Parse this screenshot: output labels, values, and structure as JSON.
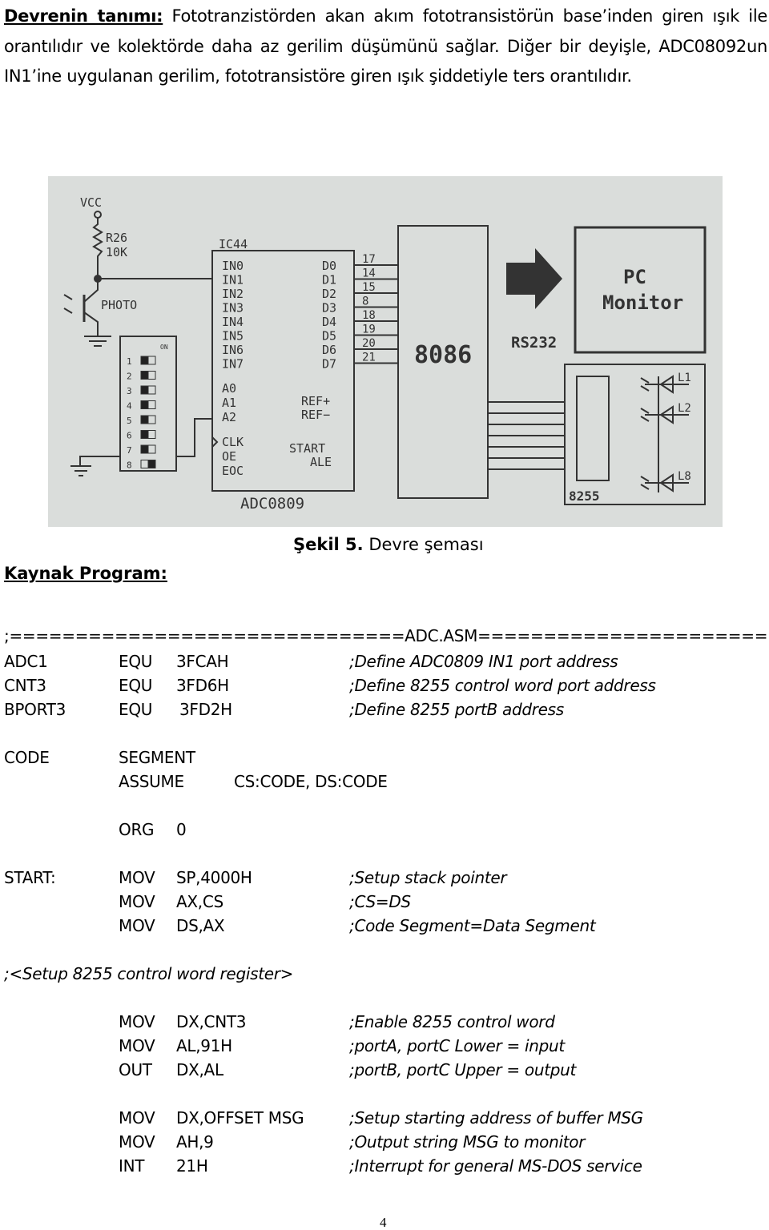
{
  "intro": {
    "heading": "Devrenin tanımı:",
    "text": " Fototranzistörden akan akım fototransistörün base’inden giren ışık ile orantılıdır ve kolektörde daha az gerilim düşümünü sağlar. Diğer bir deyişle, ADC08092un IN1’ine uygulanan gerilim, fototransistöre  giren ışık şiddetiyle ters orantılıdır."
  },
  "figure": {
    "labels": {
      "vcc": "VCC",
      "r26": "R26",
      "r_val": "10K",
      "photo": "PHOTO",
      "ic": "IC44",
      "adc": "ADC0809",
      "inputs": [
        "IN0",
        "IN1",
        "IN2",
        "IN3",
        "IN4",
        "IN5",
        "IN6",
        "IN7"
      ],
      "outputs": [
        "D0",
        "D1",
        "D2",
        "D3",
        "D4",
        "D5",
        "D6",
        "D7"
      ],
      "pins": [
        "17",
        "14",
        "15",
        "8",
        "18",
        "19",
        "20",
        "21"
      ],
      "addr": [
        "A0",
        "A1",
        "A2"
      ],
      "ctrl_left": [
        "CLK",
        "OE",
        "EOC"
      ],
      "ref": [
        "REF+",
        "REF−"
      ],
      "ctrl_right": [
        "START",
        "ALE"
      ],
      "dip_numbers": [
        "1",
        "2",
        "3",
        "4",
        "5",
        "6",
        "7",
        "8"
      ],
      "dip_on": "ON",
      "cpu": "8086",
      "rs232": "RS232",
      "pc_monitor_1": "PC",
      "pc_monitor_2": "Monitor",
      "ppi": "8255",
      "leds": [
        "L1",
        "L2",
        "L8"
      ]
    },
    "caption_bold": "Şekil 5.",
    "caption_text": " Devre şeması"
  },
  "section_title": "Kaynak Program:",
  "code": {
    "header": ";==============================ADC.ASM===================================",
    "lines": [
      {
        "label": "ADC1",
        "op": "EQU",
        "arg": "3FCAH",
        "comment": ";Define ADC0809 IN1 port address"
      },
      {
        "label": "CNT3",
        "op": "EQU",
        "arg": "3FD6H",
        "comment": ";Define 8255 control word port address"
      },
      {
        "label": "BPORT3",
        "op": "EQU",
        "arg": "3FD2H",
        "comment": ";Define 8255 portB address"
      },
      {
        "label": "CODE",
        "op": "SEGMENT",
        "arg": "",
        "comment": ""
      },
      {
        "label": "",
        "op": "ASSUME",
        "arg": "CS:CODE, DS:CODE",
        "comment": ""
      },
      {
        "label": "",
        "op": "ORG",
        "arg": "0",
        "comment": ""
      },
      {
        "label": "START:",
        "op": "MOV",
        "arg": "SP,4000H",
        "comment": ";Setup stack pointer"
      },
      {
        "label": "",
        "op": "MOV",
        "arg": "AX,CS",
        "comment": ";CS=DS"
      },
      {
        "label": "",
        "op": "MOV",
        "arg": "DS,AX",
        "comment": ";Code Segment=Data Segment"
      },
      {
        "label": ";<Setup 8255 control word register>",
        "op": "",
        "arg": "",
        "comment": ""
      },
      {
        "label": "",
        "op": "MOV",
        "arg": "DX,CNT3",
        "comment": ";Enable 8255 control word"
      },
      {
        "label": "",
        "op": "MOV",
        "arg": "AL,91H",
        "comment": ";portA, portC Lower = input"
      },
      {
        "label": "",
        "op": "OUT",
        "arg": "DX,AL",
        "comment": ";portB, portC Upper = output"
      },
      {
        "label": "",
        "op": "MOV",
        "arg": "DX,OFFSET MSG",
        "comment": ";Setup starting address of buffer MSG"
      },
      {
        "label": "",
        "op": "MOV",
        "arg": "AH,9",
        "comment": ";Output string MSG to monitor"
      },
      {
        "label": "",
        "op": "INT",
        "arg": "21H",
        "comment": ";Interrupt for general MS-DOS service"
      }
    ]
  },
  "page_number": "4"
}
